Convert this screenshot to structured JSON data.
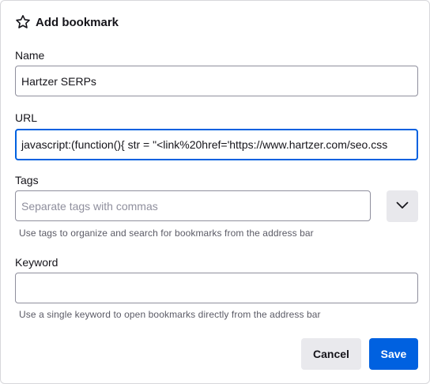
{
  "dialog": {
    "title": "Add bookmark",
    "title_icon": "star-icon"
  },
  "name": {
    "label": "Name",
    "value": "Hartzer SERPs"
  },
  "url": {
    "label": "URL",
    "value": "javascript:(function(){   str = \"<link%20href='https://www.hartzer.com/seo.css"
  },
  "tags": {
    "label": "Tags",
    "value": "",
    "placeholder": "Separate tags with commas",
    "hint": "Use tags to organize and search for bookmarks from the address bar",
    "dropdown_icon": "chevron-down-icon"
  },
  "keyword": {
    "label": "Keyword",
    "value": "",
    "hint": "Use a single keyword to open bookmarks directly from the address bar"
  },
  "buttons": {
    "cancel_label": "Cancel",
    "save_label": "Save"
  },
  "colors": {
    "accent": "#0061e0",
    "border": "#8f8f9d",
    "button_gray": "#e9e9ed",
    "hint_text": "#5b5b66"
  }
}
